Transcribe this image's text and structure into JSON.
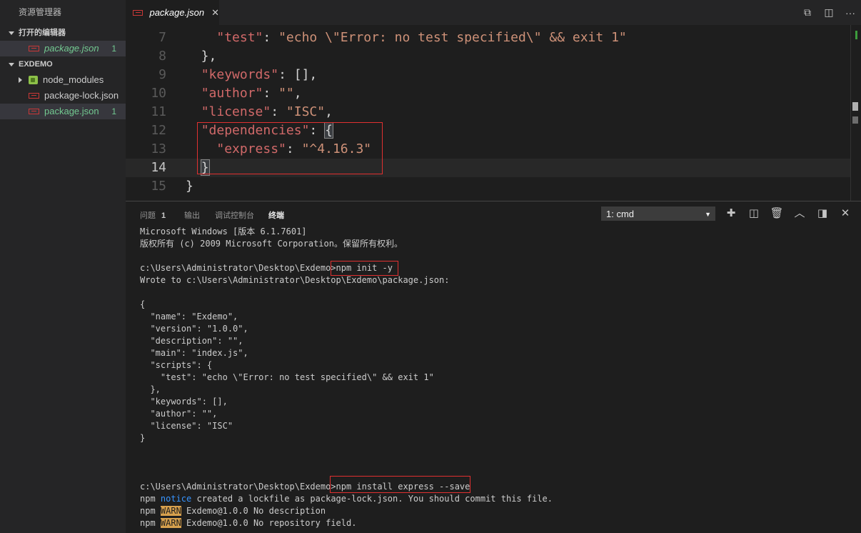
{
  "sidebar": {
    "title": "资源管理器",
    "open_editors_header": "打开的编辑器",
    "open_editors": [
      {
        "label": "package.json",
        "count": "1"
      }
    ],
    "project_header": "EXDEMO",
    "tree": [
      {
        "label": "node_modules",
        "type": "folder"
      },
      {
        "label": "package-lock.json",
        "type": "file"
      },
      {
        "label": "package.json",
        "type": "file",
        "count": "1"
      }
    ]
  },
  "tabs": {
    "active": {
      "label": "package.json",
      "close": "✕"
    },
    "actions": [
      "open-changes-icon",
      "split-editor-icon",
      "more-icon"
    ]
  },
  "editor": {
    "lines": [
      {
        "n": "7",
        "tokens": [
          [
            "p",
            "    "
          ],
          [
            "k",
            "\"test\""
          ],
          [
            "p",
            ": "
          ],
          [
            "s",
            "\"echo \\\"Error: no test specified\\\" && exit 1\""
          ]
        ]
      },
      {
        "n": "8",
        "tokens": [
          [
            "p",
            "  },"
          ]
        ]
      },
      {
        "n": "9",
        "tokens": [
          [
            "p",
            "  "
          ],
          [
            "k",
            "\"keywords\""
          ],
          [
            "p",
            ": [],"
          ]
        ]
      },
      {
        "n": "10",
        "tokens": [
          [
            "p",
            "  "
          ],
          [
            "k",
            "\"author\""
          ],
          [
            "p",
            ": "
          ],
          [
            "s",
            "\"\""
          ],
          [
            "p",
            ","
          ]
        ]
      },
      {
        "n": "11",
        "tokens": [
          [
            "p",
            "  "
          ],
          [
            "k",
            "\"license\""
          ],
          [
            "p",
            ": "
          ],
          [
            "s",
            "\"ISC\""
          ],
          [
            "p",
            ","
          ]
        ]
      },
      {
        "n": "12",
        "tokens": [
          [
            "p",
            "  "
          ],
          [
            "k",
            "\"dependencies\""
          ],
          [
            "p",
            ": "
          ],
          [
            "b",
            "{"
          ]
        ]
      },
      {
        "n": "13",
        "tokens": [
          [
            "p",
            "    "
          ],
          [
            "k",
            "\"express\""
          ],
          [
            "p",
            ": "
          ],
          [
            "s",
            "\"^4.16.3\""
          ]
        ]
      },
      {
        "n": "14",
        "tokens": [
          [
            "p",
            "  "
          ],
          [
            "b",
            "}"
          ]
        ]
      },
      {
        "n": "15",
        "tokens": [
          [
            "p",
            "}"
          ]
        ]
      }
    ]
  },
  "panel": {
    "tabs": [
      {
        "label": "问题",
        "count": "1"
      },
      {
        "label": "输出"
      },
      {
        "label": "调试控制台"
      },
      {
        "label": "终端",
        "active": true
      }
    ],
    "terminal_select": "1: cmd",
    "actions": [
      "plus-icon",
      "split-terminal-icon",
      "trash-icon",
      "chevron-up-icon",
      "maximize-panel-icon",
      "close-icon"
    ]
  },
  "terminal": {
    "lines": [
      "Microsoft Windows [版本 6.1.7601]",
      "版权所有 (c) 2009 Microsoft Corporation。保留所有权利。",
      "",
      "c:\\Users\\Administrator\\Desktop\\Exdemo>npm init -y",
      "Wrote to c:\\Users\\Administrator\\Desktop\\Exdemo\\package.json:",
      "",
      "{",
      "  \"name\": \"Exdemo\",",
      "  \"version\": \"1.0.0\",",
      "  \"description\": \"\",",
      "  \"main\": \"index.js\",",
      "  \"scripts\": {",
      "    \"test\": \"echo \\\"Error: no test specified\\\" && exit 1\"",
      "  },",
      "  \"keywords\": [],",
      "  \"author\": \"\",",
      "  \"license\": \"ISC\"",
      "}",
      "",
      "",
      "",
      "c:\\Users\\Administrator\\Desktop\\Exdemo>npm install express --save"
    ],
    "npm_lines": [
      {
        "prefix": "npm ",
        "level": "notice",
        "text": " created a lockfile as package-lock.json. You should commit this file."
      },
      {
        "prefix": "npm ",
        "level": "WARN",
        "text": " Exdemo@1.0.0 No description"
      },
      {
        "prefix": "npm ",
        "level": "WARN",
        "text": " Exdemo@1.0.0 No repository field."
      }
    ]
  }
}
